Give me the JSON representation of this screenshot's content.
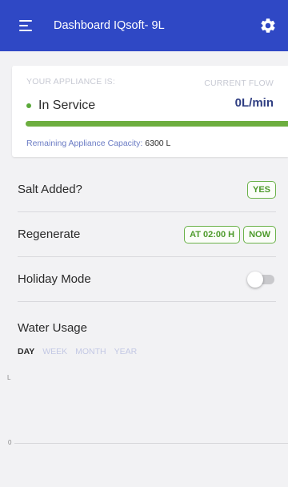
{
  "header": {
    "title": "Dashboard IQsoft- 9L",
    "menu_icon": "hamburger-menu-icon",
    "settings_icon": "gear-icon",
    "color": "#2f48c5"
  },
  "status_card": {
    "appliance_label": "YOUR APPLIANCE IS:",
    "status": "In Service",
    "status_color": "#5aa93a",
    "flow_label": "CURRENT FLOW",
    "flow_value": "0L/min",
    "capacity_progress": 1.0,
    "capacity_label": "Remaining Appliance Capacity:",
    "capacity_value": "6300 L"
  },
  "settings": {
    "salt_added": {
      "label": "Salt Added?",
      "button": "YES"
    },
    "regenerate": {
      "label": "Regenerate",
      "schedule_button": "AT 02:00 H",
      "now_button": "NOW"
    },
    "holiday_mode": {
      "label": "Holiday Mode",
      "enabled": false
    }
  },
  "usage": {
    "title": "Water Usage",
    "tabs": [
      "DAY",
      "WEEK",
      "MONTH",
      "YEAR"
    ],
    "active_tab": "DAY",
    "axis_unit": "L",
    "axis_zero": "0"
  }
}
